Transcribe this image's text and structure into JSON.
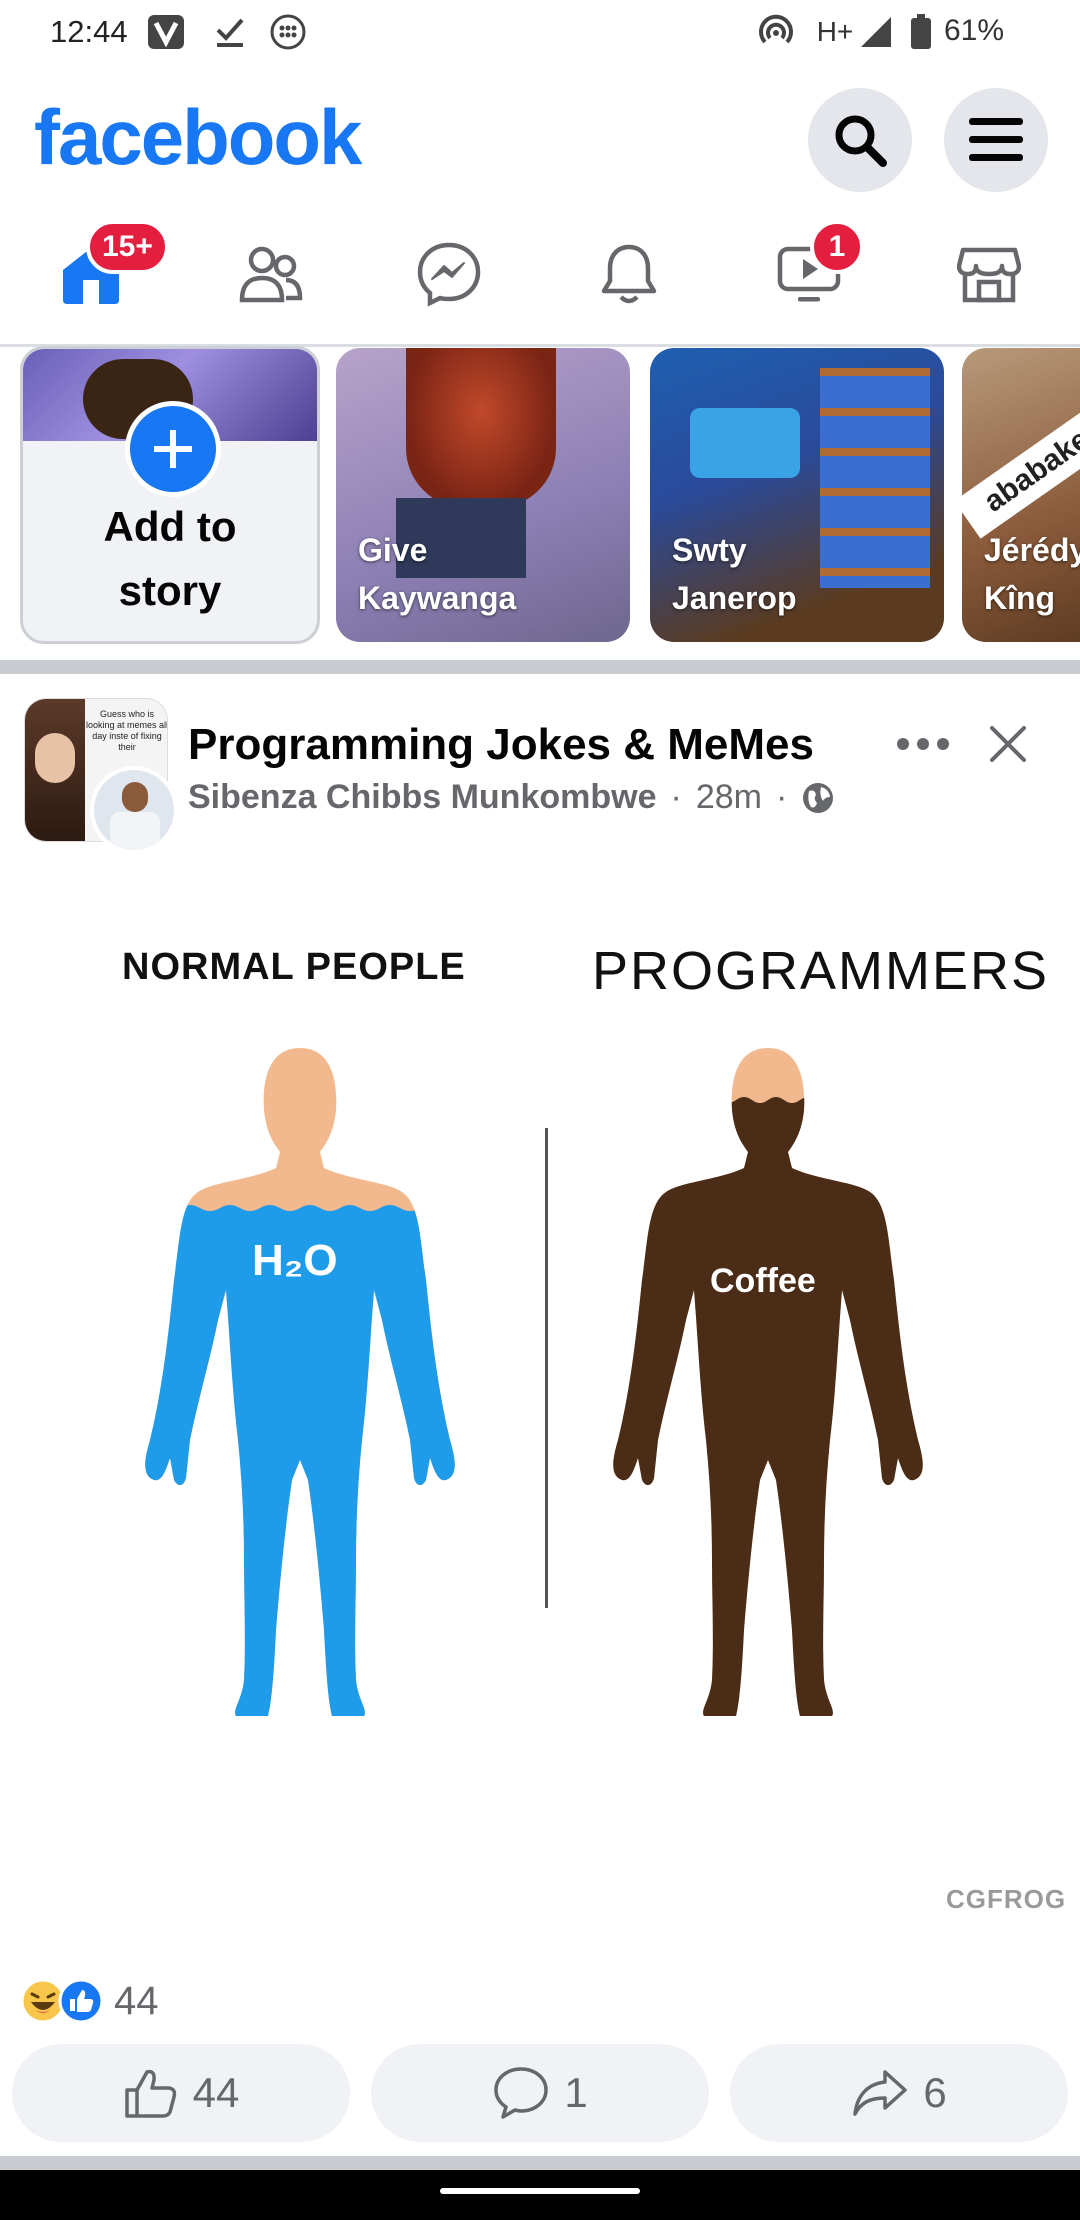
{
  "status_bar": {
    "time": "12:44",
    "network": "H+",
    "battery": "61%"
  },
  "header": {
    "logo": "facebook"
  },
  "nav": {
    "home_badge": "15+",
    "video_badge": "1"
  },
  "stories": [
    {
      "label": "Add to\nstory",
      "type": "create"
    },
    {
      "label": "Give\nKaywanga"
    },
    {
      "label": "Swty\nJanerop"
    },
    {
      "label": "Jérédy\nKîng",
      "overlay_text": "ababake"
    }
  ],
  "post": {
    "page_name": "Programming Jokes & MeMes",
    "author": "Sibenza Chibbs Munkombwe",
    "time": "28m",
    "separator": "·",
    "avatar_caption": "Guess who is looking at memes all day inste of fixing their",
    "meme": {
      "left_heading": "NORMAL PEOPLE",
      "right_heading": "PROGRAMMERS",
      "left_label": "H₂O",
      "right_label": "Coffee",
      "watermark": "CGFROG"
    },
    "reactions": {
      "count": "44",
      "types": [
        "haha",
        "like"
      ]
    },
    "actions": {
      "like_count": "44",
      "comment_count": "1",
      "share_count": "6"
    }
  },
  "colors": {
    "brand": "#1877f2",
    "badge": "#e41e3f",
    "water": "#1e9be9",
    "coffee": "#4a2c17",
    "skin": "#f2b98f"
  }
}
